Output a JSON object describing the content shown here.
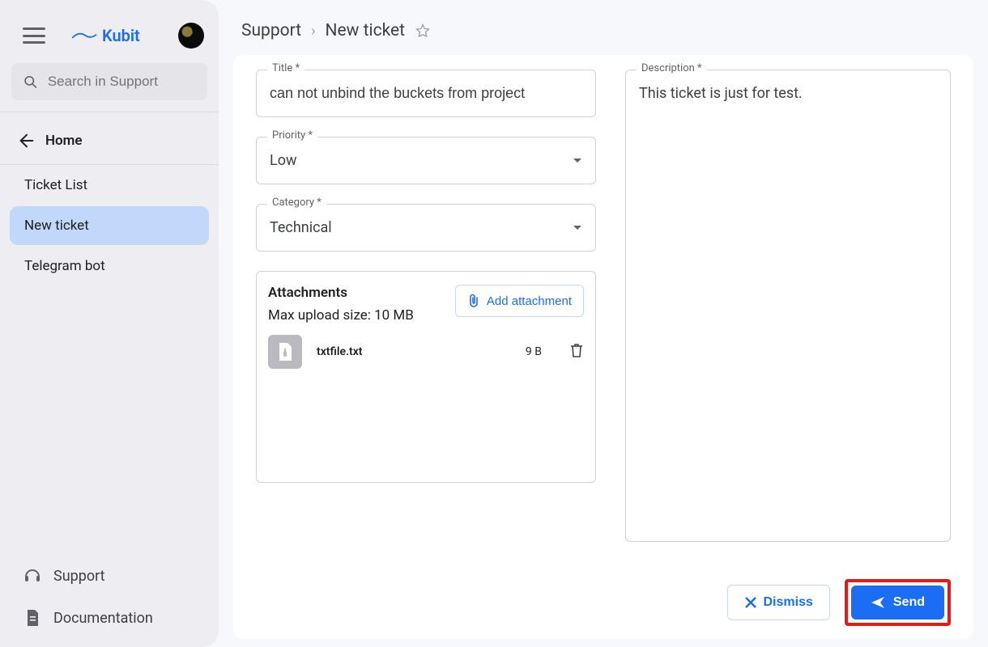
{
  "brand": {
    "name": "Kubit"
  },
  "search": {
    "placeholder": "Search in Support"
  },
  "home": {
    "label": "Home"
  },
  "sidebar": {
    "items": [
      {
        "label": "Ticket List"
      },
      {
        "label": "New ticket"
      },
      {
        "label": "Telegram bot"
      }
    ]
  },
  "bottom_links": {
    "support": "Support",
    "documentation": "Documentation"
  },
  "breadcrumbs": {
    "a": "Support",
    "b": "New ticket"
  },
  "form": {
    "title": {
      "label": "Title *",
      "value": "can not unbind the buckets from project"
    },
    "priority": {
      "label": "Priority *",
      "value": "Low"
    },
    "category": {
      "label": "Category *",
      "value": "Technical"
    },
    "description": {
      "label": "Description *",
      "value": "This ticket is just for test."
    },
    "attachments": {
      "heading": "Attachments",
      "hint": "Max upload size: 10 MB",
      "add_label": "Add attachment",
      "files": [
        {
          "name": "txtfile.txt",
          "size": "9 B"
        }
      ]
    }
  },
  "actions": {
    "dismiss": "Dismiss",
    "send": "Send"
  }
}
